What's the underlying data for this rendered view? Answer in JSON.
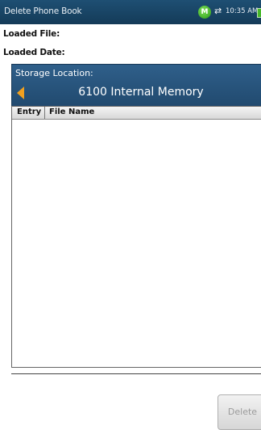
{
  "window": {
    "title": "Delete Phone Book",
    "status_badge": "M",
    "swap_icon": "⇄",
    "clock": "10:35 AM",
    "battery_color": "#46b82a"
  },
  "fields": {
    "loaded_file_label": "Loaded File:",
    "loaded_date_label": "Loaded Date:"
  },
  "storage": {
    "label": "Storage Location:",
    "value": "6100 Internal Memory",
    "arrow_color": "#f0a020"
  },
  "table": {
    "columns": [
      "Entry",
      "File Name"
    ],
    "rows": []
  },
  "actions": {
    "delete_label": "Delete"
  }
}
